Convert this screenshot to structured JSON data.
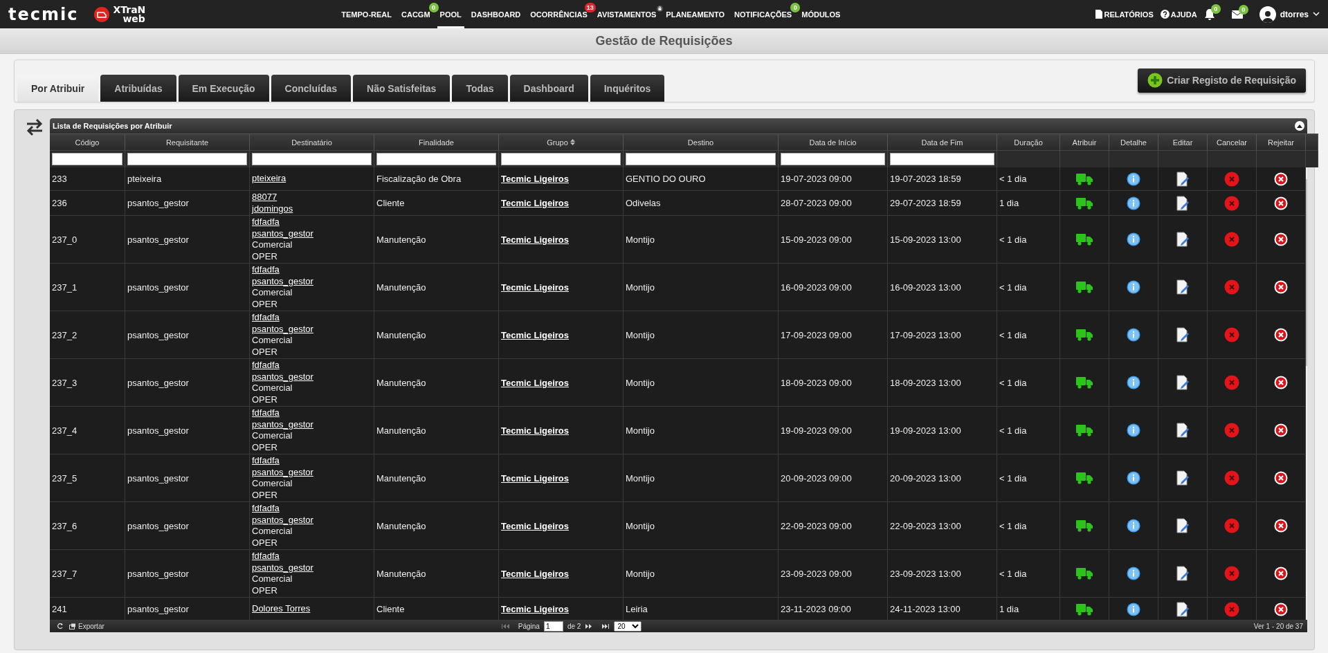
{
  "brand": {
    "logo": "tecmic",
    "product_top": "XTraN",
    "product_bottom": "web"
  },
  "nav": [
    {
      "label": "TEMPO-REAL",
      "selected": false
    },
    {
      "label": "CACGM",
      "selected": false,
      "badge": {
        "text": "0",
        "color": "#7cc242"
      }
    },
    {
      "label": "POOL",
      "selected": true
    },
    {
      "label": "DASHBOARD",
      "selected": false
    },
    {
      "label": "OCORRÊNCIAS",
      "selected": false,
      "badge": {
        "text": "13",
        "color": "#e0262b"
      }
    },
    {
      "label": "AVISTAMENTOS",
      "selected": false,
      "locked": true
    },
    {
      "label": "PLANEAMENTO",
      "selected": false
    },
    {
      "label": "NOTIFICAÇÕES",
      "selected": false,
      "badge": {
        "text": "0",
        "color": "#7cc242"
      }
    },
    {
      "label": "MÓDULOS",
      "selected": false
    }
  ],
  "top_right": {
    "reports": "RELATÓRIOS",
    "help": "AJUDA",
    "alerts_badge": "0",
    "messages_badge": "0",
    "user": "dtorres"
  },
  "page_title": "Gestão de Requisições",
  "tabs": [
    {
      "label": "Por Atribuir",
      "selected": true
    },
    {
      "label": "Atribuídas",
      "selected": false
    },
    {
      "label": "Em Execução",
      "selected": false
    },
    {
      "label": "Concluídas",
      "selected": false
    },
    {
      "label": "Não Satisfeitas",
      "selected": false
    },
    {
      "label": "Todas",
      "selected": false
    },
    {
      "label": "Dashboard",
      "selected": false
    },
    {
      "label": "Inquéritos",
      "selected": false
    }
  ],
  "create_button": "Criar Registo de Requisição",
  "table": {
    "caption": "Lista de Requisições por Atribuir",
    "columns": [
      {
        "label": "Código",
        "filter": true
      },
      {
        "label": "Requisitante",
        "filter": true
      },
      {
        "label": "Destinatário",
        "filter": true
      },
      {
        "label": "Finalidade",
        "filter": true
      },
      {
        "label": "Grupo",
        "filter": true,
        "sortable": true
      },
      {
        "label": "Destino",
        "filter": true
      },
      {
        "label": "Data de Início",
        "filter": true
      },
      {
        "label": "Data de Fim",
        "filter": true
      },
      {
        "label": "Duração",
        "filter": false
      },
      {
        "label": "Atribuir",
        "filter": false
      },
      {
        "label": "Detalhe",
        "filter": false
      },
      {
        "label": "Editar",
        "filter": false
      },
      {
        "label": "Cancelar",
        "filter": false
      },
      {
        "label": "Rejeitar",
        "filter": false
      }
    ],
    "rows": [
      {
        "code": "233",
        "requester": "pteixeira",
        "recipients": [
          {
            "kind": "link",
            "text": "pteixeira"
          }
        ],
        "purpose": "Fiscalização de Obra",
        "group": "Tecmic Ligeiros",
        "destination": "GENTIO DO OURO",
        "start": "19-07-2023 09:00",
        "end": "19-07-2023 18:59",
        "duration": "< 1 dia"
      },
      {
        "code": "236",
        "requester": "psantos_gestor",
        "recipients": [
          {
            "kind": "link",
            "text": "88077"
          },
          {
            "kind": "link",
            "text": "jdomingos"
          }
        ],
        "purpose": "Cliente",
        "group": "Tecmic Ligeiros",
        "destination": "Odivelas",
        "start": "28-07-2023 09:00",
        "end": "29-07-2023 18:59",
        "duration": "1 dia"
      },
      {
        "code": "237_0",
        "requester": "psantos_gestor",
        "recipients": [
          {
            "kind": "link",
            "text": "fdfadfa"
          },
          {
            "kind": "link",
            "text": "psantos_gestor"
          },
          {
            "kind": "text",
            "text": "Comercial"
          },
          {
            "kind": "text",
            "text": "OPER"
          }
        ],
        "purpose": "Manutenção",
        "group": "Tecmic Ligeiros",
        "destination": "Montijo",
        "start": "15-09-2023 09:00",
        "end": "15-09-2023 13:00",
        "duration": "< 1 dia"
      },
      {
        "code": "237_1",
        "requester": "psantos_gestor",
        "recipients": [
          {
            "kind": "link",
            "text": "fdfadfa"
          },
          {
            "kind": "link",
            "text": "psantos_gestor"
          },
          {
            "kind": "text",
            "text": "Comercial"
          },
          {
            "kind": "text",
            "text": "OPER"
          }
        ],
        "purpose": "Manutenção",
        "group": "Tecmic Ligeiros",
        "destination": "Montijo",
        "start": "16-09-2023 09:00",
        "end": "16-09-2023 13:00",
        "duration": "< 1 dia"
      },
      {
        "code": "237_2",
        "requester": "psantos_gestor",
        "recipients": [
          {
            "kind": "link",
            "text": "fdfadfa"
          },
          {
            "kind": "link",
            "text": "psantos_gestor"
          },
          {
            "kind": "text",
            "text": "Comercial"
          },
          {
            "kind": "text",
            "text": "OPER"
          }
        ],
        "purpose": "Manutenção",
        "group": "Tecmic Ligeiros",
        "destination": "Montijo",
        "start": "17-09-2023 09:00",
        "end": "17-09-2023 13:00",
        "duration": "< 1 dia"
      },
      {
        "code": "237_3",
        "requester": "psantos_gestor",
        "recipients": [
          {
            "kind": "link",
            "text": "fdfadfa"
          },
          {
            "kind": "link",
            "text": "psantos_gestor"
          },
          {
            "kind": "text",
            "text": "Comercial"
          },
          {
            "kind": "text",
            "text": "OPER"
          }
        ],
        "purpose": "Manutenção",
        "group": "Tecmic Ligeiros",
        "destination": "Montijo",
        "start": "18-09-2023 09:00",
        "end": "18-09-2023 13:00",
        "duration": "< 1 dia"
      },
      {
        "code": "237_4",
        "requester": "psantos_gestor",
        "recipients": [
          {
            "kind": "link",
            "text": "fdfadfa"
          },
          {
            "kind": "link",
            "text": "psantos_gestor"
          },
          {
            "kind": "text",
            "text": "Comercial"
          },
          {
            "kind": "text",
            "text": "OPER"
          }
        ],
        "purpose": "Manutenção",
        "group": "Tecmic Ligeiros",
        "destination": "Montijo",
        "start": "19-09-2023 09:00",
        "end": "19-09-2023 13:00",
        "duration": "< 1 dia"
      },
      {
        "code": "237_5",
        "requester": "psantos_gestor",
        "recipients": [
          {
            "kind": "link",
            "text": "fdfadfa"
          },
          {
            "kind": "link",
            "text": "psantos_gestor"
          },
          {
            "kind": "text",
            "text": "Comercial"
          },
          {
            "kind": "text",
            "text": "OPER"
          }
        ],
        "purpose": "Manutenção",
        "group": "Tecmic Ligeiros",
        "destination": "Montijo",
        "start": "20-09-2023 09:00",
        "end": "20-09-2023 13:00",
        "duration": "< 1 dia"
      },
      {
        "code": "237_6",
        "requester": "psantos_gestor",
        "recipients": [
          {
            "kind": "link",
            "text": "fdfadfa"
          },
          {
            "kind": "link",
            "text": "psantos_gestor"
          },
          {
            "kind": "text",
            "text": "Comercial"
          },
          {
            "kind": "text",
            "text": "OPER"
          }
        ],
        "purpose": "Manutenção",
        "group": "Tecmic Ligeiros",
        "destination": "Montijo",
        "start": "22-09-2023 09:00",
        "end": "22-09-2023 13:00",
        "duration": "< 1 dia"
      },
      {
        "code": "237_7",
        "requester": "psantos_gestor",
        "recipients": [
          {
            "kind": "link",
            "text": "fdfadfa"
          },
          {
            "kind": "link",
            "text": "psantos_gestor"
          },
          {
            "kind": "text",
            "text": "Comercial"
          },
          {
            "kind": "text",
            "text": "OPER"
          }
        ],
        "purpose": "Manutenção",
        "group": "Tecmic Ligeiros",
        "destination": "Montijo",
        "start": "23-09-2023 09:00",
        "end": "23-09-2023 13:00",
        "duration": "< 1 dia"
      },
      {
        "code": "241",
        "requester": "psantos_gestor",
        "recipients": [
          {
            "kind": "link",
            "text": "Dolores Torres"
          }
        ],
        "purpose": "Cliente",
        "group": "Tecmic Ligeiros",
        "destination": "Leiria",
        "start": "23-11-2023 09:00",
        "end": "24-11-2023 13:00",
        "duration": "1 dia"
      }
    ]
  },
  "pager": {
    "export": "Exportar",
    "page_label": "Página",
    "page": "1",
    "of": "de 2",
    "page_size": "20",
    "summary": "Ver 1 - 20 de 37"
  }
}
